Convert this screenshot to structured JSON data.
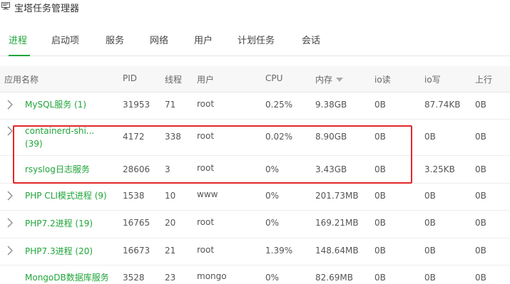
{
  "app": {
    "title": "宝塔任务管理器"
  },
  "tabs": [
    "进程",
    "启动项",
    "服务",
    "网络",
    "用户",
    "计划任务",
    "会话"
  ],
  "active_tab": 0,
  "columns": [
    "应用名称",
    "PID",
    "线程",
    "用户",
    "CPU",
    "内存",
    "io读",
    "io写",
    "上行"
  ],
  "sorted_column": "内存",
  "rows": [
    {
      "name": "MySQL服务 (1)",
      "pid": "31953",
      "threads": "71",
      "user": "root",
      "cpu": "0.25%",
      "mem": "9.38GB",
      "io_read": "0B",
      "io_write": "87.74KB",
      "up": "0B",
      "expandable": true
    },
    {
      "name": "containerd-shi...",
      "name2": "(39)",
      "pid": "4172",
      "threads": "338",
      "user": "root",
      "cpu": "0.02%",
      "mem": "8.90GB",
      "io_read": "0B",
      "io_write": "0B",
      "up": "0B",
      "expandable": true
    },
    {
      "name": "rsyslog日志服务",
      "pid": "28606",
      "threads": "3",
      "user": "root",
      "cpu": "0%",
      "mem": "3.43GB",
      "io_read": "0B",
      "io_write": "3.25KB",
      "up": "0B",
      "expandable": false
    },
    {
      "name": "PHP CLI模式进程 (9)",
      "pid": "1538",
      "threads": "10",
      "user": "www",
      "cpu": "0%",
      "mem": "201.73MB",
      "io_read": "0B",
      "io_write": "0B",
      "up": "0B",
      "expandable": true
    },
    {
      "name": "PHP7.2进程 (19)",
      "pid": "16765",
      "threads": "20",
      "user": "root",
      "cpu": "0%",
      "mem": "169.21MB",
      "io_read": "0B",
      "io_write": "0B",
      "up": "0B",
      "expandable": true
    },
    {
      "name": "PHP7.3进程 (20)",
      "pid": "16673",
      "threads": "21",
      "user": "root",
      "cpu": "1.39%",
      "mem": "148.64MB",
      "io_read": "0B",
      "io_write": "0B",
      "up": "0B",
      "expandable": true
    },
    {
      "name": "MongoDB数据库服务",
      "pid": "3528",
      "threads": "23",
      "user": "mongo",
      "cpu": "0%",
      "mem": "82.69MB",
      "io_read": "0B",
      "io_write": "0B",
      "up": "0B",
      "expandable": false
    }
  ],
  "icons": {
    "app": "task-manager-icon",
    "expand": "chevron-right-icon",
    "sort": "sort-desc-icon"
  },
  "colors": {
    "accent": "#20a53a",
    "highlight": "#e32727"
  }
}
